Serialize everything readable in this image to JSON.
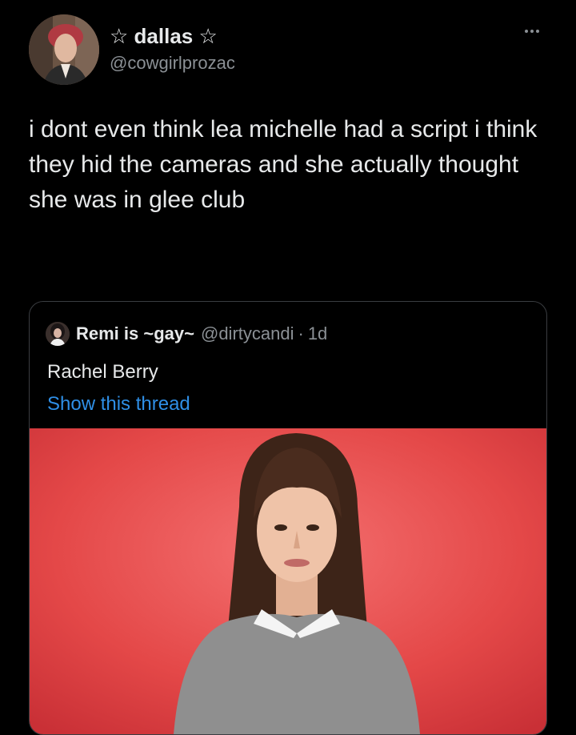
{
  "tweet": {
    "display_name": "☆ dallas ☆",
    "handle": "@cowgirlprozac",
    "text": "i dont even think lea michelle had a script i think they hid the cameras and she actually thought she was in glee club"
  },
  "quoted_tweet": {
    "display_name": "Remi is ~gay~",
    "handle": "@dirtycandi",
    "separator": "·",
    "time": "1d",
    "text": "Rachel Berry",
    "show_thread_label": "Show this thread"
  },
  "colors": {
    "background": "#000000",
    "text": "#e7e9ea",
    "secondary_text": "#8b9095",
    "link": "#2f8fe6",
    "border": "#3a3d41",
    "photo_background": "#e44848"
  },
  "icons": {
    "more": "more-horizontal-icon"
  }
}
